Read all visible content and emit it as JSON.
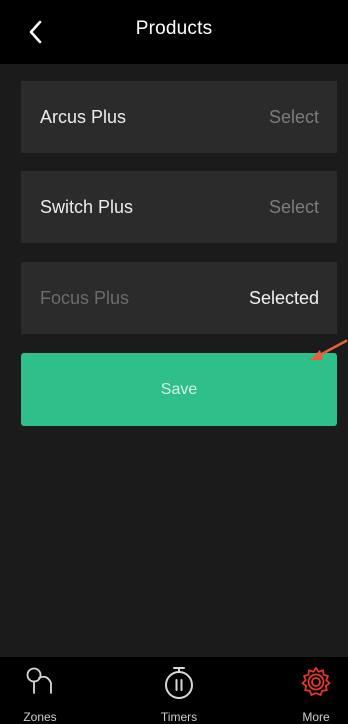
{
  "header": {
    "title": "Products",
    "back_icon": "chevron-left-icon"
  },
  "products": [
    {
      "name": "Arcus Plus",
      "action": "Select",
      "selected": false
    },
    {
      "name": "Switch Plus",
      "action": "Select",
      "selected": false
    },
    {
      "name": "Focus Plus",
      "action": "Selected",
      "selected": true
    }
  ],
  "save_label": "Save",
  "colors": {
    "accent": "#2ebf8a",
    "annotation_arrow": "#e8603a",
    "active_tab": "#e6392b"
  },
  "tabbar": {
    "tabs": [
      {
        "label": "Zones",
        "icon": "zones-icon",
        "active": false
      },
      {
        "label": "Timers",
        "icon": "timer-icon",
        "active": false
      },
      {
        "label": "More",
        "icon": "gear-icon",
        "active": true
      }
    ]
  }
}
